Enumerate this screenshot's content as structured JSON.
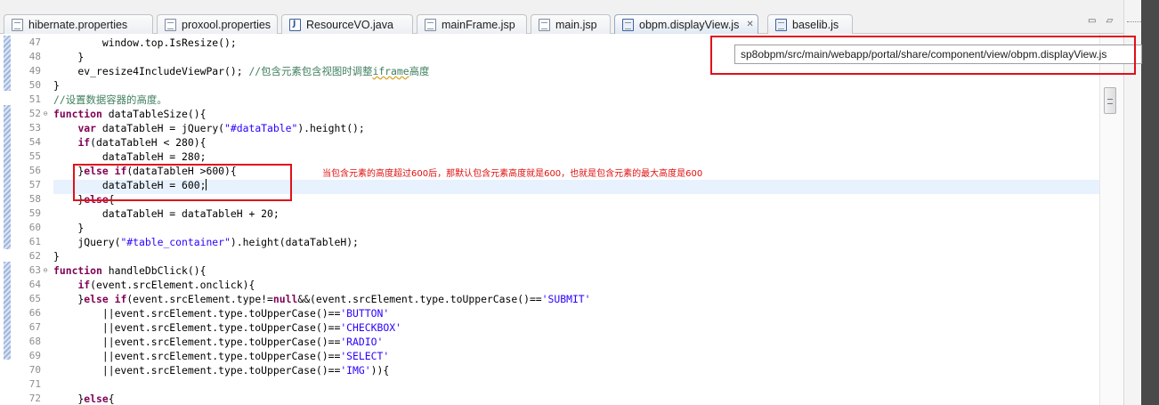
{
  "tabs": [
    {
      "label": "hibernate.properties",
      "icon": "properties-file-icon"
    },
    {
      "label": "proxool.properties",
      "icon": "properties-file-icon"
    },
    {
      "label": "ResourceVO.java",
      "icon": "java-file-icon"
    },
    {
      "label": "mainFrame.jsp",
      "icon": "jsp-file-icon"
    },
    {
      "label": "main.jsp",
      "icon": "jsp-file-icon"
    },
    {
      "label": "obpm.displayView.js",
      "icon": "js-file-icon",
      "active": true,
      "close": "✕"
    },
    {
      "label": "baselib.js",
      "icon": "js-file-icon"
    }
  ],
  "view_controls": "▭ ▱",
  "tooltip": "sp8obpm/src/main/webapp/portal/share/component/view/obpm.displayView.js",
  "annotation_note": "当包含元素的高度超过600后，那默认包含元素高度就是600，也就是包含元素的最大高度是600",
  "highlight_color": "#e0101a",
  "line_numbers": [
    {
      "n": "47",
      "fold": ""
    },
    {
      "n": "48",
      "fold": ""
    },
    {
      "n": "49",
      "fold": ""
    },
    {
      "n": "50",
      "fold": ""
    },
    {
      "n": "51",
      "fold": ""
    },
    {
      "n": "52",
      "fold": "⊖"
    },
    {
      "n": "53",
      "fold": ""
    },
    {
      "n": "54",
      "fold": ""
    },
    {
      "n": "55",
      "fold": ""
    },
    {
      "n": "56",
      "fold": ""
    },
    {
      "n": "57",
      "fold": ""
    },
    {
      "n": "58",
      "fold": ""
    },
    {
      "n": "59",
      "fold": ""
    },
    {
      "n": "60",
      "fold": ""
    },
    {
      "n": "61",
      "fold": ""
    },
    {
      "n": "62",
      "fold": ""
    },
    {
      "n": "63",
      "fold": "⊖"
    },
    {
      "n": "64",
      "fold": ""
    },
    {
      "n": "65",
      "fold": ""
    },
    {
      "n": "66",
      "fold": ""
    },
    {
      "n": "67",
      "fold": ""
    },
    {
      "n": "68",
      "fold": ""
    },
    {
      "n": "69",
      "fold": ""
    },
    {
      "n": "70",
      "fold": ""
    },
    {
      "n": "71",
      "fold": ""
    },
    {
      "n": "72",
      "fold": ""
    }
  ],
  "code_lines": [
    "        window.top.IsResize();",
    "    }",
    "    ev_resize4IncludeViewPar(); //包含元素包含视图时调整iframe高度",
    "}",
    "//设置数据容器的高度。",
    "function dataTableSize(){",
    "    var dataTableH = jQuery(\"#dataTable\").height();",
    "    if(dataTableH < 280){",
    "        dataTableH = 280;",
    "    }else if(dataTableH >600){",
    "        dataTableH = 600;",
    "    }else{",
    "        dataTableH = dataTableH + 20;",
    "    }",
    "    jQuery(\"#table_container\").height(dataTableH);",
    "}",
    "function handleDbClick(){",
    "    if(event.srcElement.onclick){",
    "    }else if(event.srcElement.type!=null&&(event.srcElement.type.toUpperCase()=='SUBMIT'",
    "        ||event.srcElement.type.toUpperCase()=='BUTTON'",
    "        ||event.srcElement.type.toUpperCase()=='CHECKBOX'",
    "        ||event.srcElement.type.toUpperCase()=='RADIO'",
    "        ||event.srcElement.type.toUpperCase()=='SELECT'",
    "        ||event.srcElement.type.toUpperCase()=='IMG')){",
    "",
    "    }else{"
  ]
}
